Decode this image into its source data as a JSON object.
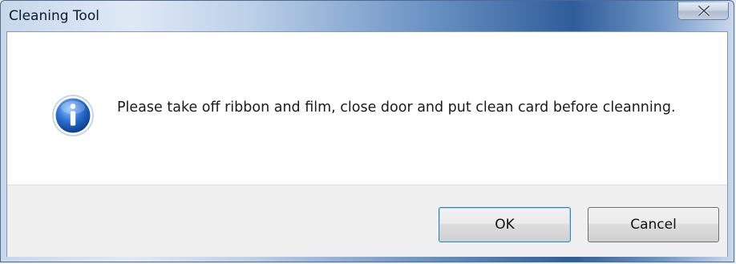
{
  "window": {
    "title": "Cleaning Tool",
    "close_icon": "close-x-icon"
  },
  "dialog": {
    "icon": "info-icon",
    "message": "Please take off ribbon and film, close door and put clean card before cleanning."
  },
  "buttons": {
    "ok_label": "OK",
    "cancel_label": "Cancel"
  },
  "colors": {
    "title_bar_accent": "#2f5d9a",
    "info_icon_blue": "#1f5fb8",
    "footer_bg": "#f0f0f0",
    "default_button_border": "#3c7fb1"
  }
}
